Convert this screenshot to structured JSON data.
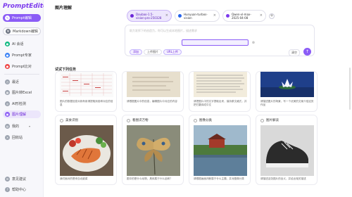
{
  "brand": "PromptEditor",
  "sidebar": {
    "items": [
      {
        "label": "Prompt编辑"
      },
      {
        "label": "Markdown编辑"
      },
      {
        "label": "AI 会话"
      },
      {
        "label": "Prompt专家"
      },
      {
        "label": "Prompt比对"
      },
      {
        "label": "最近"
      },
      {
        "label": "图片转Excel"
      },
      {
        "label": "AI形检测"
      },
      {
        "label": "图片理解"
      },
      {
        "label": "我的"
      },
      {
        "label": "回收站"
      },
      {
        "label": "意见建议"
      },
      {
        "label": "帮助中心"
      }
    ]
  },
  "page_title": "图片理解",
  "tabs": [
    {
      "label": "Doubao-1.5-vision-pro-250328"
    },
    {
      "label": "Hunyuan-turbos-vision"
    },
    {
      "label": "Qwen-vl-max-2025-04-08"
    }
  ],
  "input": {
    "placeholder": "助力发挥下的创造力，你可以生成本地图片，描述需求",
    "chips": [
      "添加",
      "上传图片",
      "URL上传"
    ],
    "clear_label": "清空"
  },
  "section_label": "试试下列任务",
  "cards_top": [
    {
      "desc": "图片的数据信息对我有用请提取到各种对应的信息"
    },
    {
      "desc": "请根据图片中的信息，编辑图片中对应的内容"
    },
    {
      "desc": "请把图片中的文字提取出来，保持原文格式，并把它翻译成中文"
    },
    {
      "desc": "请描述图片的场景，写一个优美的文案介绍这张作品"
    }
  ],
  "cards_bottom": [
    {
      "title": "美食识别",
      "desc": "我们面对的是来自北欧菜"
    },
    {
      "title": "看图识万物",
      "desc": "图中的是什么动物，具体属于什么品种？"
    },
    {
      "title": "图像分类",
      "desc": "请根据画面判断属于什么主题，并对图像分类"
    },
    {
      "title": "图片解读",
      "desc": "请描述这张图片的含义，并给出相关描述"
    }
  ]
}
